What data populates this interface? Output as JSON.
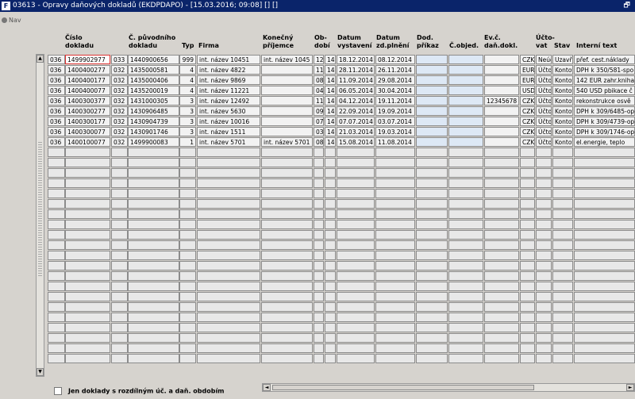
{
  "window": {
    "title": "03613 - Opravy daňových dokladů (EKDPDAPO) - [15.03.2016; 09:08] [] []",
    "app_icon": "F",
    "restore_glyph": "🗗"
  },
  "nav": {
    "label": "Nav"
  },
  "headers": {
    "cislo": "Číslo\ndokladu",
    "puvodni": "Č. původního\ndokladu",
    "typ": "Typ",
    "firma": "Firma",
    "konecny": "Konečný\npříjemce",
    "obdobi": "Ob-\ndobí",
    "vystaveni": "Datum\nvystavení",
    "plneni": "Datum\nzd.plnění",
    "prikaz": "Dod.\npříkaz",
    "objed": "Č.objed.",
    "evc": "Ev.č.\ndaň.dokl.",
    "uctovat": "Účto-\nvat",
    "stav": "Stav",
    "text": "Interní text"
  },
  "rows": [
    {
      "a": "036",
      "b": "1499902977",
      "c": "033",
      "d": "1440900656",
      "typ": "999",
      "firma": "int. název 10451",
      "kon": "int. název 1045",
      "o1": "12",
      "o2": "14",
      "vys": "18.12.2014",
      "pln": "08.12.2014",
      "prik": "",
      "obj": "",
      "evc": "",
      "mena": "CZK",
      "uct": "Neúč",
      "stav": "Uzavř",
      "text": "přef. cest.náklady"
    },
    {
      "a": "036",
      "b": "1400400277",
      "c": "032",
      "d": "1435000581",
      "typ": "4",
      "firma": "int. název 4822",
      "kon": "",
      "o1": "11",
      "o2": "14",
      "vys": "28.11.2014",
      "pln": "26.11.2014",
      "prik": "",
      "obj": "",
      "evc": "",
      "mena": "EUR",
      "uct": "Účto",
      "stav": "Kontov",
      "text": "DPH k 350/581-spo"
    },
    {
      "a": "036",
      "b": "1400400177",
      "c": "032",
      "d": "1435000406",
      "typ": "4",
      "firma": "int. název 9869",
      "kon": "",
      "o1": "08",
      "o2": "14",
      "vys": "11.09.2014",
      "pln": "29.08.2014",
      "prik": "",
      "obj": "",
      "evc": "",
      "mena": "EUR",
      "uct": "Účto",
      "stav": "Kontov",
      "text": "142 EUR zahr.kniha"
    },
    {
      "a": "036",
      "b": "1400400077",
      "c": "032",
      "d": "1435200019",
      "typ": "4",
      "firma": "int. název 11221",
      "kon": "",
      "o1": "04",
      "o2": "14",
      "vys": "06.05.2014",
      "pln": "30.04.2014",
      "prik": "",
      "obj": "",
      "evc": "",
      "mena": "USD",
      "uct": "Účto",
      "stav": "Kontov",
      "text": "540 USD pbikace č"
    },
    {
      "a": "036",
      "b": "1400300377",
      "c": "032",
      "d": "1431000305",
      "typ": "3",
      "firma": "int. název 12492",
      "kon": "",
      "o1": "11",
      "o2": "14",
      "vys": "04.12.2014",
      "pln": "19.11.2014",
      "prik": "",
      "obj": "",
      "evc": "12345678",
      "mena": "CZK",
      "uct": "Účto",
      "stav": "Kontov",
      "text": "rekonstrukce osvě"
    },
    {
      "a": "036",
      "b": "1400300277",
      "c": "032",
      "d": "1430906485",
      "typ": "3",
      "firma": "int. název 5630",
      "kon": "",
      "o1": "09",
      "o2": "14",
      "vys": "22.09.2014",
      "pln": "19.09.2014",
      "prik": "",
      "obj": "",
      "evc": "",
      "mena": "CZK",
      "uct": "Účto",
      "stav": "Kontov",
      "text": "DPH k 309/6485-op"
    },
    {
      "a": "036",
      "b": "1400300177",
      "c": "032",
      "d": "1430904739",
      "typ": "3",
      "firma": "int. název 10016",
      "kon": "",
      "o1": "07",
      "o2": "14",
      "vys": "07.07.2014",
      "pln": "03.07.2014",
      "prik": "",
      "obj": "",
      "evc": "",
      "mena": "CZK",
      "uct": "Účto",
      "stav": "Kontov",
      "text": "DPH k 309/4739-op"
    },
    {
      "a": "036",
      "b": "1400300077",
      "c": "032",
      "d": "1430901746",
      "typ": "3",
      "firma": "int. název 1511",
      "kon": "",
      "o1": "03",
      "o2": "14",
      "vys": "21.03.2014",
      "pln": "19.03.2014",
      "prik": "",
      "obj": "",
      "evc": "",
      "mena": "CZK",
      "uct": "Účto",
      "stav": "Kontov",
      "text": "DPH k 309/1746-op"
    },
    {
      "a": "036",
      "b": "1400100077",
      "c": "032",
      "d": "1499900083",
      "typ": "1",
      "firma": "int. název 5701",
      "kon": "int. název 5701",
      "o1": "08",
      "o2": "14",
      "vys": "15.08.2014",
      "pln": "11.08.2014",
      "prik": "",
      "obj": "",
      "evc": "",
      "mena": "CZK",
      "uct": "Účto",
      "stav": "Kontov",
      "text": "el.energie, teplo"
    }
  ],
  "empty_row_count": 21,
  "footer": {
    "checkbox_label": "Jen doklady s rozdílným úč. a daň. obdobím",
    "checked": false
  },
  "scroll": {
    "up": "▲",
    "down": "▼",
    "left": "◄",
    "right": "►"
  }
}
